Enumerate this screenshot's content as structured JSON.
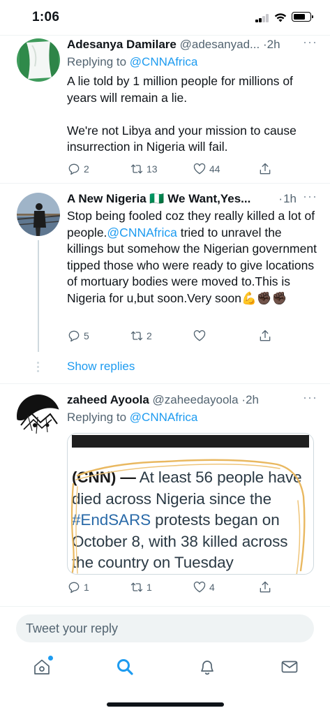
{
  "status_bar": {
    "time": "1:06"
  },
  "tweets": [
    {
      "name": "Adesanya Damilare",
      "handle": "@adesanyad...",
      "time": "2h",
      "replying_prefix": "Replying to ",
      "replying_to": "@CNNAfrica",
      "body": "A lie told by 1 million people for millions of years will remain a lie.\n\nWe're not Libya and your mission to cause insurrection in Nigeria will fail.",
      "replies": "2",
      "retweets": "13",
      "likes": "44"
    },
    {
      "name": "A New Nigeria 🇳🇬 We Want,Yes...",
      "time": "1h",
      "body_before": "Stop being fooled coz they really killed a lot of people.",
      "body_mention": "@CNNAfrica",
      "body_after": " tried to unravel the killings but somehow the Nigerian government tipped those who were ready to give locations of mortuary bodies were moved to.This is Nigeria for u,but soon.Very soon💪✊🏿✊🏿",
      "replies": "5",
      "retweets": "2",
      "likes": ""
    },
    {
      "name": "zaheed Ayoola",
      "handle": "@zaheedayoola",
      "time": "2h",
      "replying_prefix": "Replying to ",
      "replying_to": "@CNNAfrica",
      "media": {
        "source": "(CNN) —",
        "text_before": " At least 56 people have died across Nigeria since the ",
        "hashtag": "#EndSARS",
        "text_after": " protests began on October 8, with 38 killed across the country on Tuesday"
      },
      "replies": "1",
      "retweets": "1",
      "likes": "4"
    }
  ],
  "show_replies": "Show replies",
  "separator": "·",
  "more": "···",
  "reply_box": {
    "placeholder": "Tweet your reply"
  },
  "tabs": [
    "home-icon",
    "search-icon",
    "notifications-icon",
    "messages-icon"
  ],
  "colors": {
    "accent": "#1d9bf0",
    "text": "#0f1419",
    "muted": "#536471"
  }
}
